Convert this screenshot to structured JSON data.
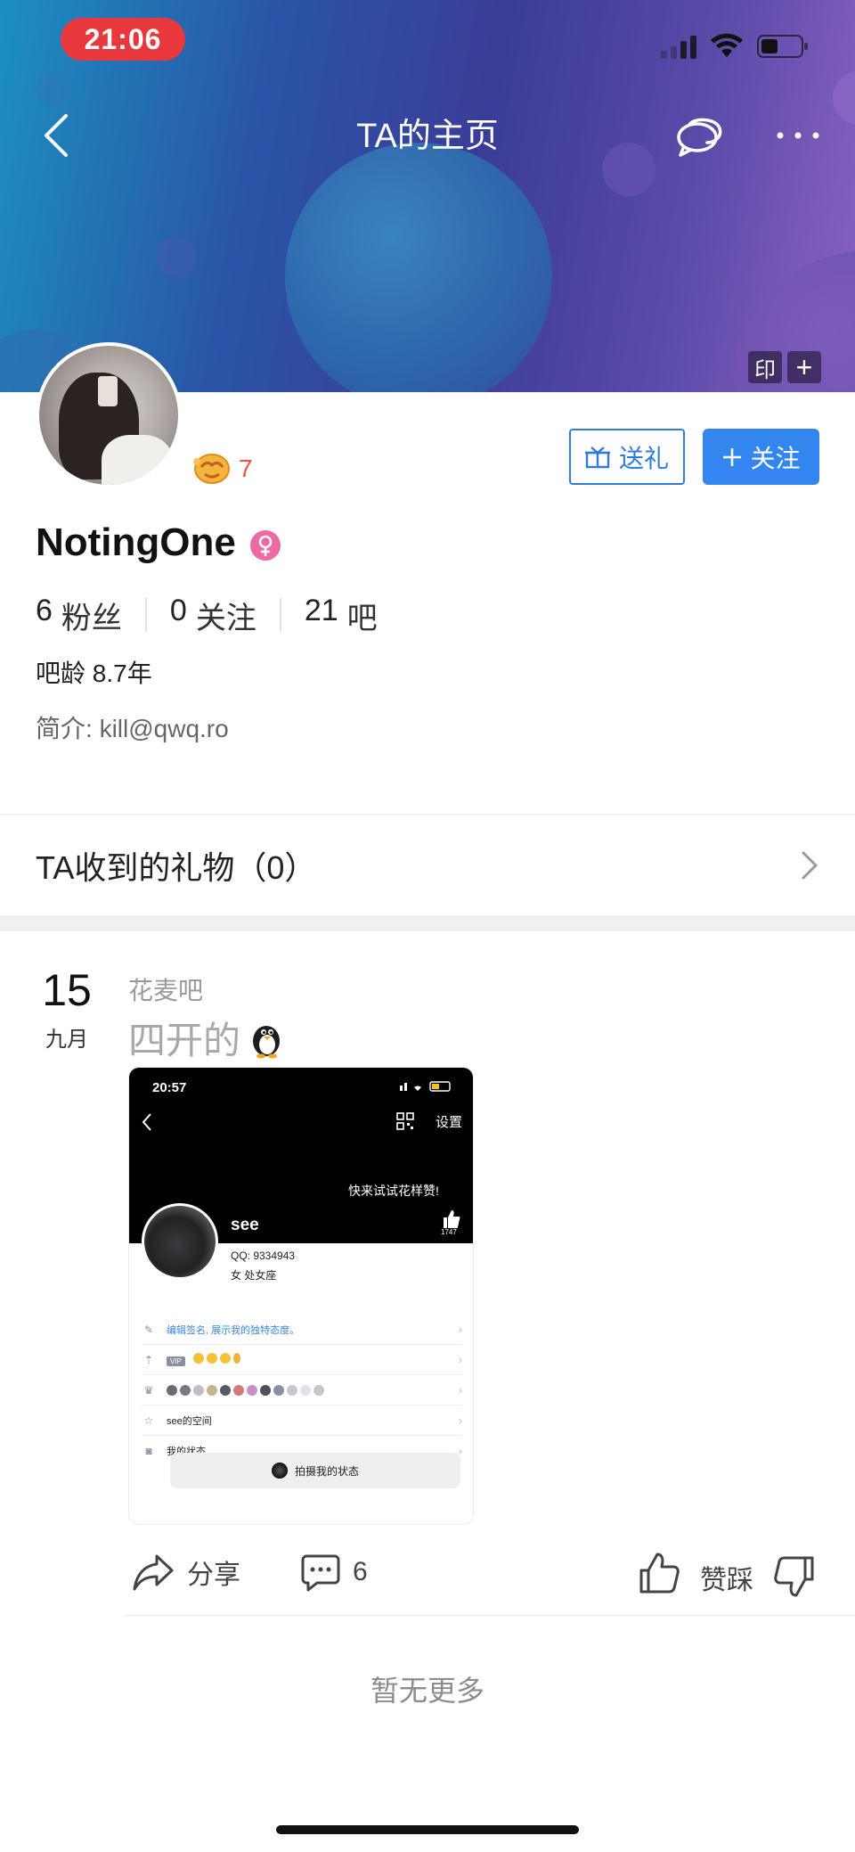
{
  "status_bar": {
    "time": "21:06"
  },
  "nav": {
    "title": "TA的主页"
  },
  "banner": {
    "stamp_label": "印",
    "plus_label": "+"
  },
  "profile": {
    "level": "7",
    "username": "NotingOne",
    "gender": "female",
    "gift_button": "送礼",
    "follow_button": "关注",
    "stats": [
      {
        "value": "6",
        "label": "粉丝"
      },
      {
        "value": "0",
        "label": "关注"
      },
      {
        "value": "21",
        "label": "吧"
      }
    ],
    "bar_age_label": "吧龄",
    "bar_age_value": "8.7年",
    "bio_label": "简介:",
    "bio_value": "kill@qwq.ro"
  },
  "gifts": {
    "label": "TA收到的礼物（0）"
  },
  "post": {
    "day": "15",
    "month": "九月",
    "forum": "花麦吧",
    "title": "四开的",
    "screenshot": {
      "time": "20:57",
      "settings": "设置",
      "promo": "快来试试花样赞!",
      "likes": "1747",
      "name": "see",
      "qq": "QQ: 9334943",
      "gender_line": "女  处女座",
      "rows": [
        {
          "icon": "pen-icon",
          "text": "编辑签名, 展示我的独特态度。"
        },
        {
          "icon": "chart-icon",
          "text": "VIP"
        },
        {
          "icon": "crown-icon",
          "text": ""
        },
        {
          "icon": "star-icon",
          "text": "see的空间"
        },
        {
          "icon": "camera-icon",
          "text": "我的状态"
        }
      ],
      "capture_button": "拍摄我的状态"
    },
    "actions": {
      "share": "分享",
      "comment_count": "6",
      "vote": "赞踩"
    }
  },
  "footer": {
    "no_more": "暂无更多"
  },
  "colors": {
    "accent": "#3385f0",
    "level": "#e8564a",
    "status_time_bg": "#e8383d"
  }
}
